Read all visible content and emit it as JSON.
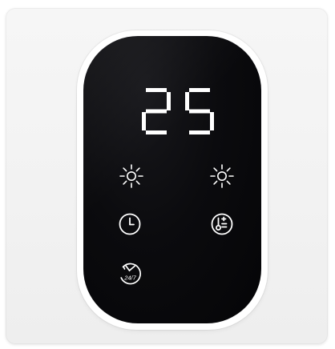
{
  "device": {
    "display": {
      "value": "25"
    },
    "buttons": {
      "brightness_left": {
        "icon": "sun-icon"
      },
      "brightness_right": {
        "icon": "sun-icon"
      },
      "timer": {
        "icon": "clock-icon"
      },
      "temperature": {
        "icon": "thermometer-icon"
      },
      "schedule": {
        "icon": "clock-24-7-icon",
        "label": "24/7"
      }
    },
    "colors": {
      "glass": "#0b0b0e",
      "glyph": "#ffffff",
      "plate": "#f2f2f2"
    }
  }
}
